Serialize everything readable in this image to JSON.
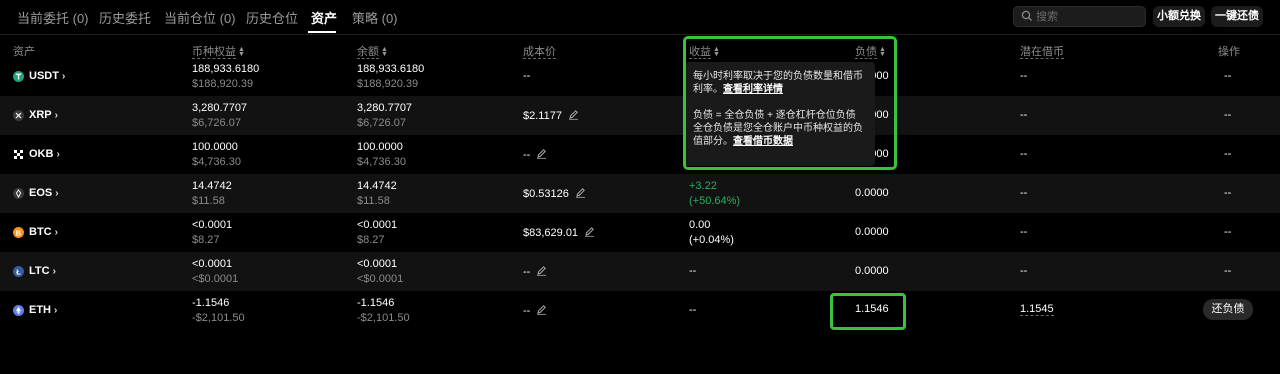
{
  "tabs": [
    {
      "label": "当前委托 (0)"
    },
    {
      "label": "历史委托"
    },
    {
      "label": "当前仓位 (0)"
    },
    {
      "label": "历史仓位"
    },
    {
      "label": "资产"
    },
    {
      "label": "策略 (0)"
    }
  ],
  "search": {
    "placeholder": "搜索"
  },
  "actions": {
    "small_convert": "小额兑换",
    "repay_all": "一键还债"
  },
  "columns": {
    "asset": "资产",
    "equity": "币种权益",
    "balance": "余额",
    "cost": "成本价",
    "pnl": "收益",
    "liability": "负债",
    "potential_borrow": "潜在借币",
    "action": "操作"
  },
  "rows": [
    {
      "coin": "USDT",
      "equity": "188,933.6180",
      "equity_usd": "$188,920.39",
      "balance": "188,933.6180",
      "balance_usd": "$188,920.39",
      "cost": "--",
      "liability": "0.0000",
      "potential": "--",
      "action": "--",
      "icon_color": "#26a17b",
      "icon": "tether-icon"
    },
    {
      "coin": "XRP",
      "equity": "3,280.7707",
      "equity_usd": "$6,726.07",
      "balance": "3,280.7707",
      "balance_usd": "$6,726.07",
      "cost": "$2.1177",
      "liability": "0.0000",
      "potential": "--",
      "action": "--",
      "icon_color": "#3a3a3a",
      "icon": "xrp-icon"
    },
    {
      "coin": "OKB",
      "equity": "100.0000",
      "equity_usd": "$4,736.30",
      "balance": "100.0000",
      "balance_usd": "$4,736.30",
      "cost": "--",
      "liability": "0.0000",
      "potential": "--",
      "action": "--",
      "icon_color": "#000000",
      "icon": "okb-icon"
    },
    {
      "coin": "EOS",
      "equity": "14.4742",
      "equity_usd": "$11.58",
      "balance": "14.4742",
      "balance_usd": "$11.58",
      "cost": "$0.53126",
      "pnl": "+3.22",
      "pnl_pct": "(+50.64%)",
      "liability": "0.0000",
      "potential": "--",
      "action": "--",
      "icon_color": "#3a3a3a",
      "icon": "eos-icon"
    },
    {
      "coin": "BTC",
      "equity": "<0.0001",
      "equity_usd": "$8.27",
      "balance": "<0.0001",
      "balance_usd": "$8.27",
      "cost": "$83,629.01",
      "pnl": "0.00",
      "pnl_pct": "(+0.04%)",
      "liability": "0.0000",
      "potential": "--",
      "action": "--",
      "icon_color": "#f7931a",
      "icon": "bitcoin-icon"
    },
    {
      "coin": "LTC",
      "equity": "<0.0001",
      "equity_usd": "<$0.0001",
      "balance": "<0.0001",
      "balance_usd": "<$0.0001",
      "cost": "--",
      "pnl": "--",
      "liability": "0.0000",
      "potential": "--",
      "action": "--",
      "icon_color": "#345d9d",
      "icon": "litecoin-icon"
    },
    {
      "coin": "ETH",
      "equity": "-1.1546",
      "equity_usd": "-$2,101.50",
      "balance": "-1.1546",
      "balance_usd": "-$2,101.50",
      "cost": "--",
      "pnl": "--",
      "liability": "1.1546",
      "potential": "1.1545",
      "action": "还负债",
      "icon_color": "#627eea",
      "icon": "ethereum-icon"
    }
  ],
  "tooltip": {
    "line1": "每小时利率取决于您的负债数量和借币利率。",
    "link1": "查看利率详情",
    "line2": "负债 = 全仓负债 + 逐仓杠杆仓位负债",
    "line3": "全仓负债是您全仓账户中币种权益的负值部分。",
    "link2": "查看借币数据"
  },
  "colors": {
    "positive": "#25b060",
    "highlight": "#38c23d",
    "background": "#000000"
  }
}
